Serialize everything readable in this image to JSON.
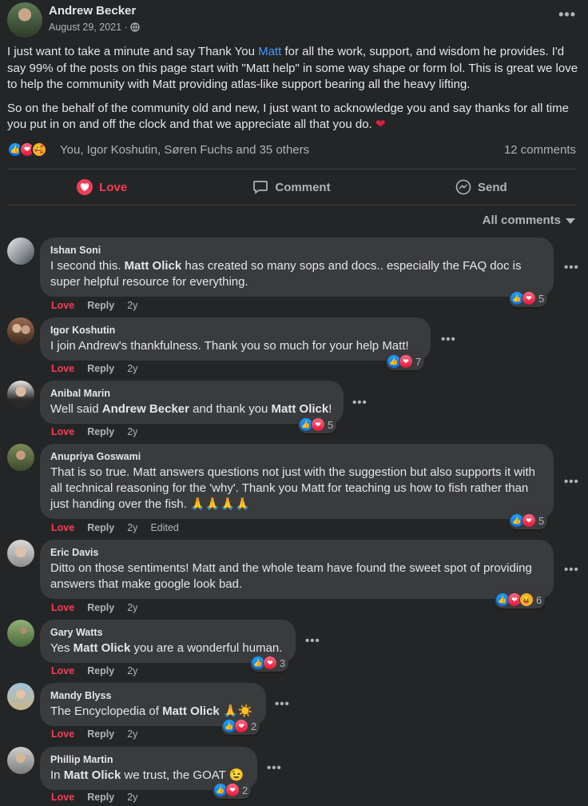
{
  "post": {
    "author": "Andrew Becker",
    "date": "August 29, 2021 ·",
    "text_p1_before": "I just want to take a minute and say Thank You ",
    "text_p1_mention": "Matt",
    "text_p1_after": " for all the work, support, and wisdom he provides. I'd say 99% of the posts on this page start with \"Matt help\" in some way shape or form lol. This is great we love to help the community with Matt providing atlas-like support bearing all the heavy lifting.",
    "text_p2": "So on the behalf of the community old and new, I just want to acknowledge you and say thanks for all time you put in on and off the clock and that we appreciate all that you do.",
    "text_p2_emoji": "❤",
    "reactions_text": "You, Igor Koshutin, Søren Fuchs and 35 others",
    "comments_count": "12 comments"
  },
  "actions": {
    "love": "Love",
    "comment": "Comment",
    "send": "Send"
  },
  "sort_label": "All comments",
  "colors": {
    "background": "#242526",
    "bubble": "#3a3b3c",
    "love": "#f33e58",
    "link": "#4599ff"
  },
  "comments": [
    {
      "name": "Ishan Soni",
      "text_parts": [
        "I second this. ",
        "Matt Olick",
        " has created so many sops and docs.. especially the FAQ doc is super helpful resource for everything."
      ],
      "love": "Love",
      "reply": "Reply",
      "time": "2y",
      "reactions": "5"
    },
    {
      "name": "Igor Koshutin",
      "text": "I join Andrew's thankfulness. Thank you so much for your help Matt!",
      "love": "Love",
      "reply": "Reply",
      "time": "2y",
      "reactions": "7"
    },
    {
      "name": "Anibal Marin",
      "text_parts": [
        "Well said ",
        "Andrew Becker",
        " and thank you ",
        "Matt Olick",
        "!"
      ],
      "love": "Love",
      "reply": "Reply",
      "time": "2y",
      "reactions": "5"
    },
    {
      "name": "Anupriya Goswami",
      "text": "That is so true. Matt answers questions not just with the suggestion but also supports it with all technical reasoning for the 'why'. Thank you Matt for teaching us how to fish rather than just handing over the fish. 🙏🙏🙏🙏",
      "love": "Love",
      "reply": "Reply",
      "time": "2y",
      "edited": "Edited",
      "reactions": "5"
    },
    {
      "name": "Eric Davis",
      "text": "Ditto on those sentiments! Matt and the whole team have found the sweet spot of providing answers that make google look bad.",
      "love": "Love",
      "reply": "Reply",
      "time": "2y",
      "reactions": "6"
    },
    {
      "name": "Gary Watts",
      "text_parts": [
        "Yes ",
        "Matt Olick",
        " you are a wonderful human."
      ],
      "love": "Love",
      "reply": "Reply",
      "time": "2y",
      "reactions": "3"
    },
    {
      "name": "Mandy Blyss",
      "text_parts": [
        "The Encyclopedia of ",
        "Matt Olick",
        " 🙏☀️"
      ],
      "love": "Love",
      "reply": "Reply",
      "time": "2y",
      "reactions": "2"
    },
    {
      "name": "Phillip Martin",
      "text_parts": [
        "In ",
        "Matt Olick",
        " we trust, the GOAT 😉"
      ],
      "love": "Love",
      "reply": "Reply",
      "time": "2y",
      "reactions": "2"
    }
  ]
}
